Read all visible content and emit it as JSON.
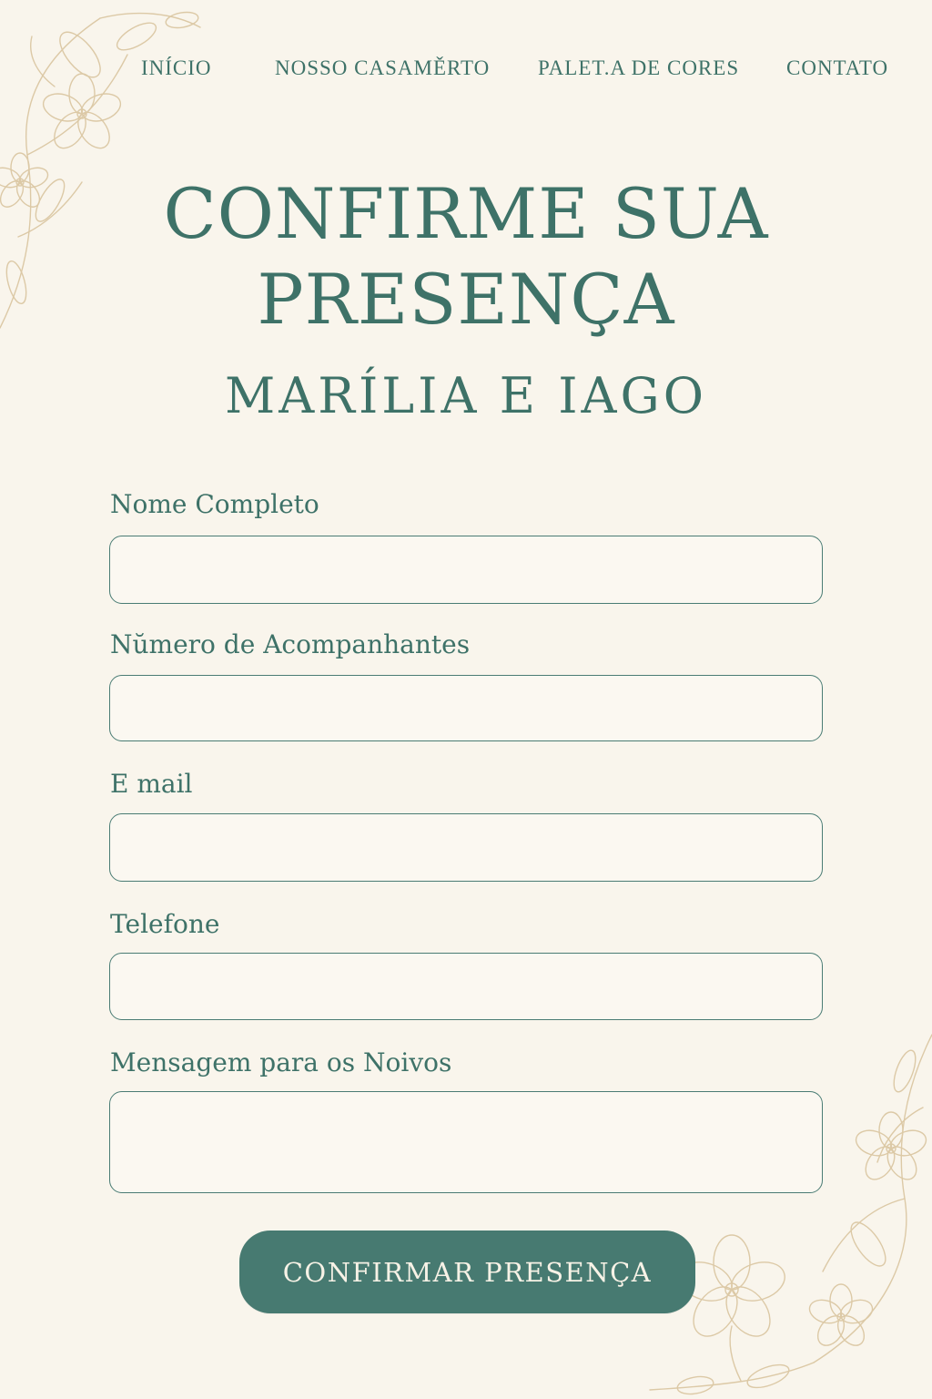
{
  "nav": {
    "items": [
      {
        "label": "INÍCIO"
      },
      {
        "label": "NOSSO CASAMĚRTO"
      },
      {
        "label": "PALET.A DE CORES"
      },
      {
        "label": "CONTATO"
      }
    ]
  },
  "header": {
    "title_line1": "CONFIRME SUA",
    "title_line2": "PRESENÇA",
    "couple": "MARÍLIA E IAGO"
  },
  "form": {
    "fields": [
      {
        "label": "Nome Completo",
        "value": ""
      },
      {
        "label": "Nŭmero de Acompanhantes",
        "value": ""
      },
      {
        "label": "E mail",
        "value": ""
      },
      {
        "label": "Telefone",
        "value": ""
      },
      {
        "label": "Mensagem para os Noivos",
        "value": ""
      }
    ],
    "submit_label": "CONFIRMAR PRESENÇA"
  },
  "decor": {
    "icon": "floral-ornament-icon",
    "color": "#dcc9a6"
  },
  "colors": {
    "background": "#f9f5ec",
    "primary": "#3e7268",
    "button": "#477a71",
    "button_text": "#f7f2e6"
  }
}
